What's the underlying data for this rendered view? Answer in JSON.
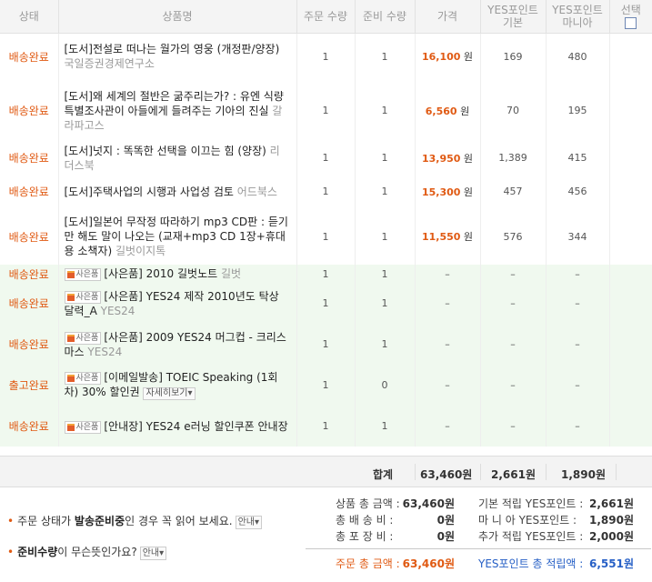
{
  "headers": {
    "status": "상태",
    "product": "상품명",
    "order_qty": "주문 수량",
    "ready_qty": "준비 수량",
    "price": "가격",
    "pt_basic_1": "YES포인트",
    "pt_basic_2": "기본",
    "pt_mania_1": "YES포인트",
    "pt_mania_2": "마니아",
    "select": "선택"
  },
  "won": "원",
  "gift_badge": "사은품",
  "more_label": "자세히보기",
  "dash": "–",
  "items": [
    {
      "status": "배송완료",
      "title": "[도서]전설로 떠나는 월가의 영웅 (개정판/양장)",
      "publisher": "국일증권경제연구소",
      "order_qty": "1",
      "ready_qty": "1",
      "price": "16,100",
      "pt_basic": "169",
      "pt_mania": "480"
    },
    {
      "status": "배송완료",
      "title": "[도서]왜 세계의 절반은 굶주리는가? : 유엔 식량특별조사관이 아들에게 들려주는 기아의 진실",
      "publisher": "갈라파고스",
      "order_qty": "1",
      "ready_qty": "1",
      "price": "6,560",
      "pt_basic": "70",
      "pt_mania": "195"
    },
    {
      "status": "배송완료",
      "title": "[도서]넛지 : 똑똑한 선택을 이끄는 힘 (양장)",
      "publisher": "리더스북",
      "order_qty": "1",
      "ready_qty": "1",
      "price": "13,950",
      "pt_basic": "1,389",
      "pt_mania": "415"
    },
    {
      "status": "배송완료",
      "title": "[도서]주택사업의 시행과 사업성 검토",
      "publisher": "어드북스",
      "order_qty": "1",
      "ready_qty": "1",
      "price": "15,300",
      "pt_basic": "457",
      "pt_mania": "456"
    },
    {
      "status": "배송완료",
      "title": "[도서]일본어 무작정 따라하기 mp3 CD판 : 듣기만 해도 말이 나오는 (교재+mp3 CD 1장+휴대용 소책자)",
      "publisher": "길벗이지톡",
      "order_qty": "1",
      "ready_qty": "1",
      "price": "11,550",
      "pt_basic": "576",
      "pt_mania": "344"
    }
  ],
  "gifts": [
    {
      "status": "배송완료",
      "title": "[사은품] 2010 길벗노트",
      "publisher": "길벗",
      "order_qty": "1",
      "ready_qty": "1"
    },
    {
      "status": "배송완료",
      "title": "[사은품] YES24 제작 2010년도 탁상 달력_A",
      "publisher": "YES24",
      "order_qty": "1",
      "ready_qty": "1"
    },
    {
      "status": "배송완료",
      "title": "[사은품] 2009 YES24 머그컵 - 크리스마스",
      "publisher": "YES24",
      "order_qty": "1",
      "ready_qty": "1"
    },
    {
      "status": "출고완료",
      "title": "[이메일발송] TOEIC Speaking (1회차) 30% 할인권",
      "publisher": "",
      "order_qty": "1",
      "ready_qty": "0"
    },
    {
      "status": "배송완료",
      "title": "[안내장] YES24 e러닝 할인쿠폰 안내장",
      "publisher": "",
      "order_qty": "1",
      "ready_qty": "1"
    }
  ],
  "totals": {
    "label": "합계",
    "price": "63,460원",
    "pt_basic": "2,661원",
    "pt_mania": "1,890원"
  },
  "notes": {
    "note1_a": "주문 상태가 ",
    "note1_b": "발송준비중",
    "note1_c": "인 경우 꼭 읽어 보세요.",
    "note1_btn": "안내",
    "note2_a": "준비수량",
    "note2_b": "이 무슨뜻인가요?",
    "note2_btn": "안내"
  },
  "summary": {
    "product_total_label": "상품 총 금액 :",
    "product_total": "63,460원",
    "shipping_label": "총 배 송 비 :",
    "shipping": "0원",
    "packing_label": "총 포 장 비 :",
    "packing": "0원",
    "order_total_label": "주문 총 금액 :",
    "order_total": "63,460원",
    "basic_pt_label": "기본 적립 YES포인트 :",
    "basic_pt": "2,661원",
    "mania_pt_label": "마 니 아 YES포인트 :",
    "mania_pt": "1,890원",
    "extra_pt_label": "추가 적립 YES포인트 :",
    "extra_pt": "2,000원",
    "total_pt_label": "YES포인트 총 적립액 :",
    "total_pt": "6,551원"
  }
}
